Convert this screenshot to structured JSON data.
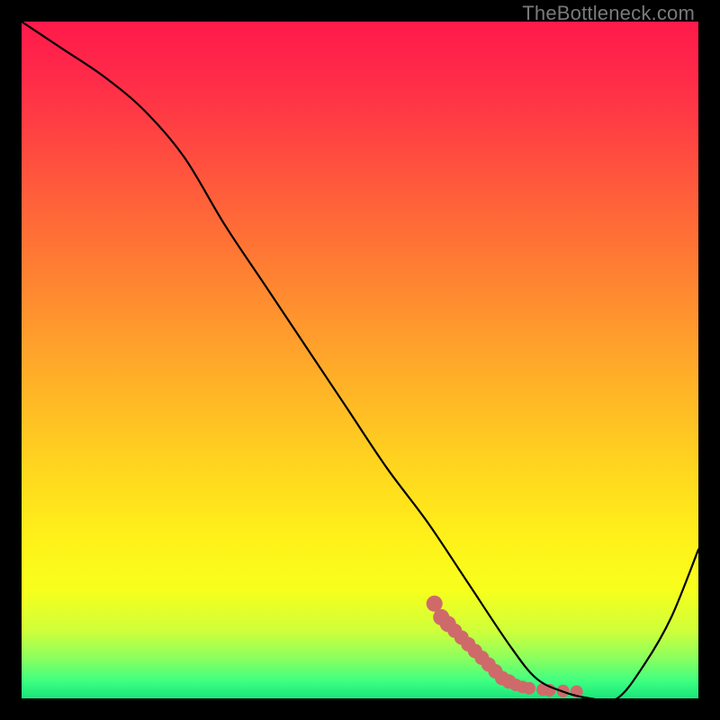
{
  "watermark": "TheBottleneck.com",
  "chart_data": {
    "type": "line",
    "title": "",
    "xlabel": "",
    "ylabel": "",
    "xlim": [
      0,
      100
    ],
    "ylim": [
      0,
      100
    ],
    "grid": false,
    "legend": false,
    "series": [
      {
        "name": "curve",
        "color": "#000000",
        "x": [
          0,
          6,
          12,
          18,
          24,
          30,
          36,
          42,
          48,
          54,
          60,
          66,
          72,
          76,
          80,
          84,
          88,
          92,
          96,
          100
        ],
        "y": [
          100,
          96,
          92,
          87,
          80,
          70,
          61,
          52,
          43,
          34,
          26,
          17,
          8,
          3,
          1,
          0,
          0,
          5,
          12,
          22
        ]
      }
    ],
    "markers": {
      "name": "highlight",
      "color": "#cf6a6a",
      "points": [
        {
          "x": 61,
          "y": 14
        },
        {
          "x": 62,
          "y": 12
        },
        {
          "x": 63,
          "y": 11
        },
        {
          "x": 64,
          "y": 10
        },
        {
          "x": 65,
          "y": 9
        },
        {
          "x": 66,
          "y": 8
        },
        {
          "x": 67,
          "y": 7
        },
        {
          "x": 68,
          "y": 6
        },
        {
          "x": 69,
          "y": 5
        },
        {
          "x": 70,
          "y": 4
        },
        {
          "x": 71,
          "y": 3
        },
        {
          "x": 72,
          "y": 2.5
        },
        {
          "x": 73,
          "y": 2
        },
        {
          "x": 74,
          "y": 1.7
        },
        {
          "x": 75,
          "y": 1.5
        },
        {
          "x": 77,
          "y": 1.3
        },
        {
          "x": 78,
          "y": 1.2
        },
        {
          "x": 80,
          "y": 1.1
        },
        {
          "x": 82,
          "y": 1.0
        }
      ]
    },
    "gradient_stops": [
      {
        "offset": 0.0,
        "color": "#ff1a4b"
      },
      {
        "offset": 0.08,
        "color": "#ff2a49"
      },
      {
        "offset": 0.18,
        "color": "#ff4741"
      },
      {
        "offset": 0.3,
        "color": "#ff6b37"
      },
      {
        "offset": 0.42,
        "color": "#ff8f2f"
      },
      {
        "offset": 0.54,
        "color": "#ffb327"
      },
      {
        "offset": 0.66,
        "color": "#ffd61f"
      },
      {
        "offset": 0.76,
        "color": "#fff01a"
      },
      {
        "offset": 0.84,
        "color": "#f7ff1c"
      },
      {
        "offset": 0.9,
        "color": "#cfff3a"
      },
      {
        "offset": 0.94,
        "color": "#8cff5e"
      },
      {
        "offset": 0.975,
        "color": "#3dff82"
      },
      {
        "offset": 1.0,
        "color": "#18e57a"
      }
    ]
  }
}
